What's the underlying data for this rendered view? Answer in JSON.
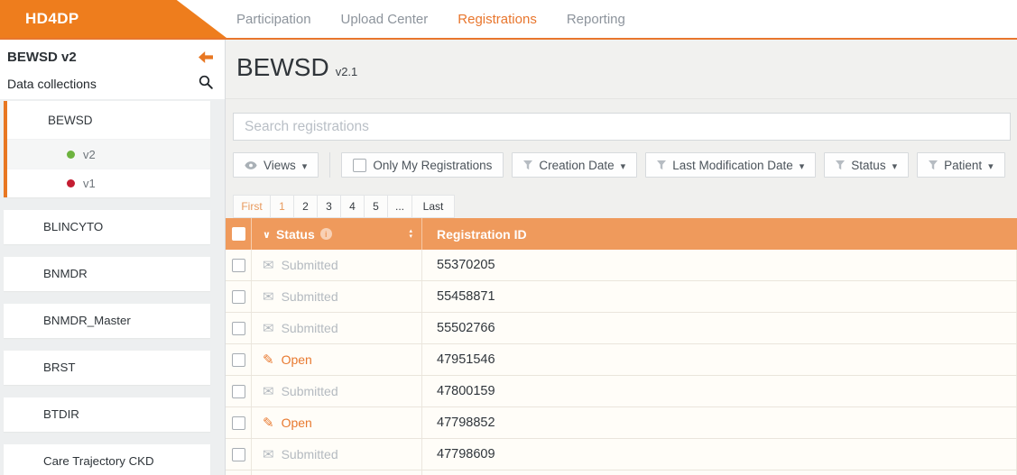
{
  "app": {
    "logo_text": "HD4DP"
  },
  "nav": {
    "tabs": [
      {
        "label": "Participation",
        "active": false
      },
      {
        "label": "Upload Center",
        "active": false
      },
      {
        "label": "Registrations",
        "active": true
      },
      {
        "label": "Reporting",
        "active": false
      }
    ]
  },
  "sidebar": {
    "collection_title": "BEWSD v2",
    "section_label": "Data collections",
    "group": {
      "label": "BEWSD",
      "versions": [
        {
          "label": "v2",
          "dot_color": "#6db33f"
        },
        {
          "label": "v1",
          "dot_color": "#c41d32"
        }
      ]
    },
    "items": [
      {
        "label": "BLINCYTO"
      },
      {
        "label": "BNMDR"
      },
      {
        "label": "BNMDR_Master"
      },
      {
        "label": "BRST"
      },
      {
        "label": "BTDIR"
      },
      {
        "label": "Care Trajectory CKD"
      }
    ]
  },
  "main": {
    "title": "BEWSD",
    "version": "v2.1",
    "search": {
      "placeholder": "Search registrations"
    },
    "filters": {
      "views": "Views",
      "only_my": "Only My Registrations",
      "creation_date": "Creation Date",
      "last_modification_date": "Last Modification Date",
      "status": "Status",
      "patient": "Patient"
    },
    "pagination": {
      "first": "First",
      "pages": [
        "1",
        "2",
        "3",
        "4",
        "5"
      ],
      "ellipsis": "...",
      "last": "Last",
      "current_page": "1"
    },
    "table": {
      "header": {
        "status": "Status",
        "registration_id": "Registration ID"
      },
      "rows": [
        {
          "status": "Submitted",
          "registration_id": "55370205"
        },
        {
          "status": "Submitted",
          "registration_id": "55458871"
        },
        {
          "status": "Submitted",
          "registration_id": "55502766"
        },
        {
          "status": "Open",
          "registration_id": "47951546"
        },
        {
          "status": "Submitted",
          "registration_id": "47800159"
        },
        {
          "status": "Open",
          "registration_id": "47798852"
        },
        {
          "status": "Submitted",
          "registration_id": "47798609"
        }
      ]
    }
  },
  "icons": {
    "collapse": "left-arrow",
    "search": "magnifier",
    "views": "eye",
    "filter": "funnel",
    "dropdown": "caret-down",
    "status_submitted": "envelope",
    "status_open": "pencil",
    "status_info": "info-circle",
    "sort": "up-down-arrows",
    "status_chevron": "chevron-down"
  },
  "colors": {
    "brand_orange": "#ee7d1d",
    "accent_orange": "#e8762d",
    "table_header_orange": "#ef9a5c",
    "status_open": "#e8792f",
    "status_submitted_gray": "#b4bac0",
    "version_dot_green": "#6db33f",
    "version_dot_red": "#c41d32"
  }
}
